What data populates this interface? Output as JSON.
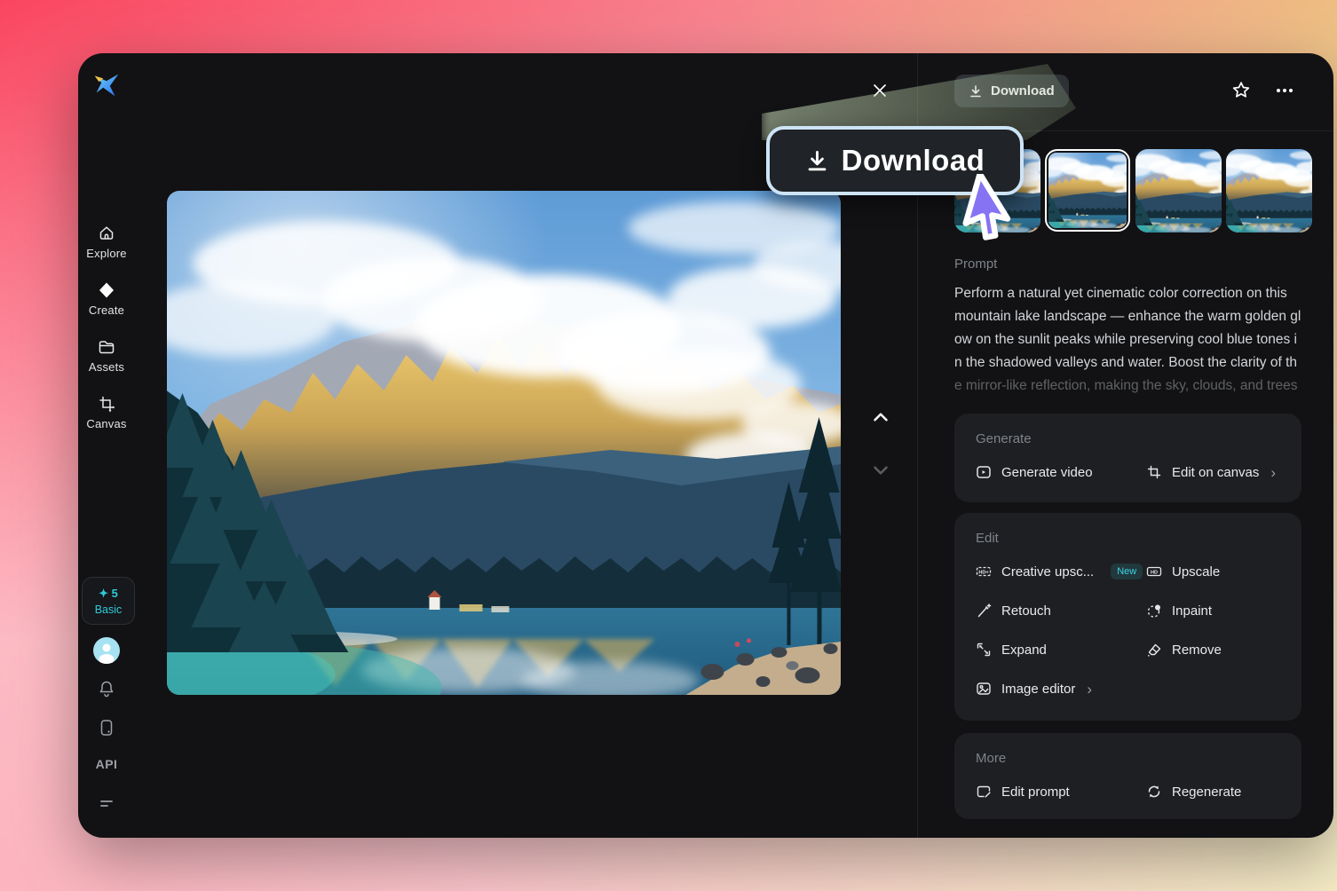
{
  "colors": {
    "accent_cyan": "#2fc9d8",
    "cursor_purple": "#8673f4",
    "callout_border": "#cde4f7",
    "selected_thumb_border": "#ffffff",
    "window_bg": "#121214",
    "card_bg": "#1d1f22"
  },
  "icons": {
    "spark": "✦",
    "chevron_right": "›",
    "upscale_text": "HD",
    "creative_upscale_text": "HD+"
  },
  "sidebar": {
    "items": [
      {
        "label": "Explore"
      },
      {
        "label": "Create"
      },
      {
        "label": "Assets"
      },
      {
        "label": "Canvas"
      }
    ],
    "plan": {
      "credits": "5",
      "tier": "Basic"
    },
    "api_label": "API"
  },
  "topbar": {
    "download_label": "Download"
  },
  "callout": {
    "label": "Download"
  },
  "thumbnails": {
    "count": 4,
    "selected_index": 2,
    "alt": "Mountain lake landscape variant"
  },
  "main_image": {
    "alt": "Mountain lake landscape with golden sunlit peaks and mirror reflection"
  },
  "prompt": {
    "label": "Prompt",
    "lines": [
      "Perform a natural yet cinematic color correction on this",
      "mountain lake landscape — enhance the warm golden gl",
      "ow on the sunlit peaks while preserving cool blue tones i",
      "n the shadowed valleys and water. Boost the clarity of th",
      "e mirror-like reflection, making the sky, clouds, and trees"
    ]
  },
  "sections": {
    "generate": {
      "title": "Generate",
      "items": [
        {
          "label": "Generate video"
        },
        {
          "label": "Edit on canvas",
          "chevron": "›"
        }
      ]
    },
    "edit": {
      "title": "Edit",
      "items": [
        {
          "label": "Creative upsc...",
          "badge": "New"
        },
        {
          "label": "Upscale"
        },
        {
          "label": "Retouch"
        },
        {
          "label": "Inpaint"
        },
        {
          "label": "Expand"
        },
        {
          "label": "Remove"
        },
        {
          "label": "Image editor",
          "chevron": "›"
        }
      ]
    },
    "more": {
      "title": "More",
      "items": [
        {
          "label": "Edit prompt"
        },
        {
          "label": "Regenerate"
        }
      ]
    }
  }
}
